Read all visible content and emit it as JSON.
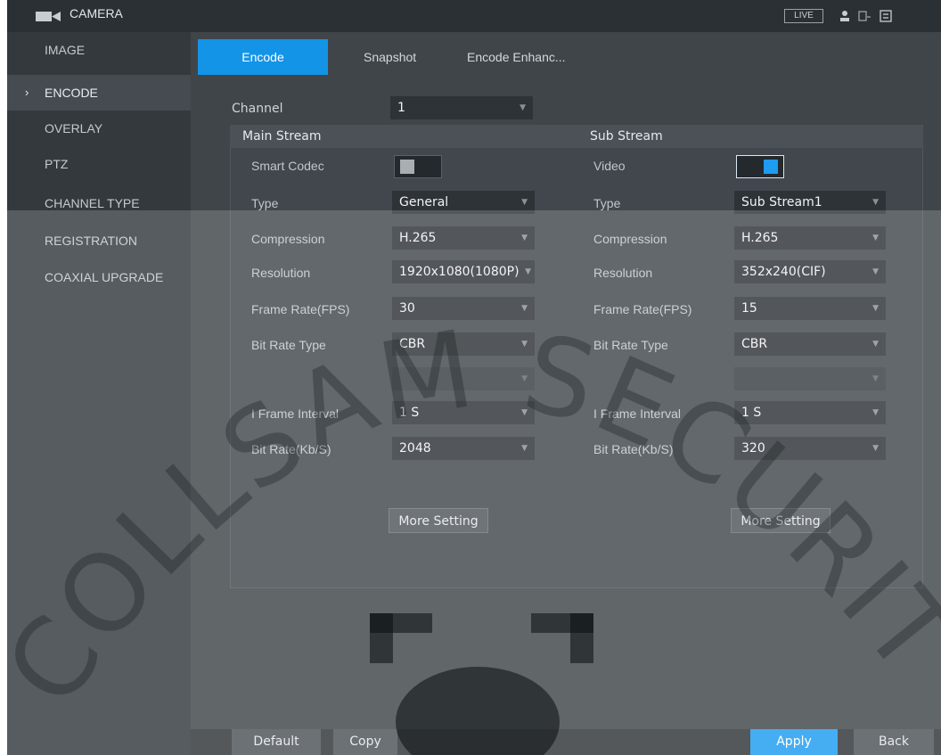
{
  "app": {
    "title": "CAMERA",
    "live_label": "LIVE"
  },
  "sidebar": {
    "items": [
      {
        "label": "IMAGE"
      },
      {
        "label": "ENCODE",
        "active": true
      },
      {
        "label": "OVERLAY"
      },
      {
        "label": "PTZ"
      },
      {
        "label": "CHANNEL TYPE"
      },
      {
        "label": "REGISTRATION"
      },
      {
        "label": "COAXIAL UPGRADE"
      }
    ]
  },
  "tabs": [
    {
      "label": "Encode",
      "active": true
    },
    {
      "label": "Snapshot"
    },
    {
      "label": "Encode Enhanc..."
    }
  ],
  "channel": {
    "label": "Channel",
    "value": "1"
  },
  "main_stream": {
    "title": "Main Stream",
    "smart_codec_label": "Smart Codec",
    "smart_codec_on": false,
    "fields": [
      {
        "label": "Type",
        "value": "General"
      },
      {
        "label": "Compression",
        "value": "H.265"
      },
      {
        "label": "Resolution",
        "value": "1920x1080(1080P)"
      },
      {
        "label": "Frame Rate(FPS)",
        "value": "30"
      },
      {
        "label": "Bit Rate Type",
        "value": "CBR"
      },
      {
        "label": "I Frame Interval",
        "value": "1 S"
      },
      {
        "label": "Bit Rate(Kb/S)",
        "value": "2048"
      }
    ],
    "more_setting": "More Setting"
  },
  "sub_stream": {
    "title": "Sub Stream",
    "video_label": "Video",
    "video_on": true,
    "fields": [
      {
        "label": "Type",
        "value": "Sub Stream1"
      },
      {
        "label": "Compression",
        "value": "H.265"
      },
      {
        "label": "Resolution",
        "value": "352x240(CIF)"
      },
      {
        "label": "Frame Rate(FPS)",
        "value": "15"
      },
      {
        "label": "Bit Rate Type",
        "value": "CBR"
      },
      {
        "label": "I Frame Interval",
        "value": "1 S"
      },
      {
        "label": "Bit Rate(Kb/S)",
        "value": "320"
      }
    ],
    "more_setting": "More Setting"
  },
  "footer": {
    "default_label": "Default",
    "copy_label": "Copy",
    "apply_label": "Apply",
    "back_label": "Back"
  },
  "colors": {
    "accent": "#1394e6",
    "background": "#3f4549",
    "sidebar": "#33393d",
    "topbar": "#2b3034"
  },
  "watermark_text": "COLLSAM SECURITY"
}
